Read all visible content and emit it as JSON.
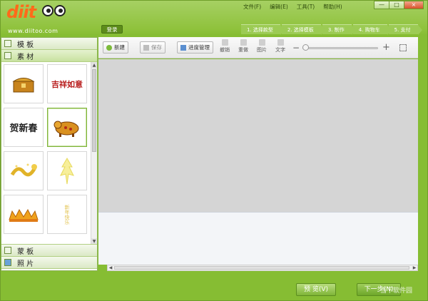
{
  "app": {
    "logo_text": "diit",
    "logo_url": "www.diitoo.com",
    "brand_color": "#ff6a1a",
    "theme_color": "#8fc23c"
  },
  "menu": [
    "文件(F)",
    "编辑(E)",
    "工具(T)",
    "帮助(H)"
  ],
  "window_controls": {
    "minimize": "—",
    "maximize": "□",
    "close": "×"
  },
  "login_label": "登录",
  "steps": [
    "1. 选择款型",
    "2. 选择模板",
    "3. 制作",
    "4. 购物车",
    "5. 支付"
  ],
  "left_panel": {
    "sections": [
      {
        "label": "模 板",
        "icon": "template-icon"
      },
      {
        "label": "素 材",
        "icon": "material-icon",
        "active": true
      },
      {
        "label": "蒙 板",
        "icon": "mask-icon"
      },
      {
        "label": "照 片",
        "icon": "photo-icon"
      }
    ],
    "thumbnails": [
      {
        "name": "treasure-chest",
        "text": ""
      },
      {
        "name": "calligraphy-red",
        "text": "吉祥如意"
      },
      {
        "name": "calligraphy-black",
        "text": "贺新春"
      },
      {
        "name": "golden-ox",
        "text": ""
      },
      {
        "name": "golden-dragon",
        "text": ""
      },
      {
        "name": "golden-ornament",
        "text": ""
      },
      {
        "name": "golden-crown",
        "text": ""
      },
      {
        "name": "calligraphy-gold",
        "text": "新年快乐"
      }
    ]
  },
  "toolbar": {
    "new_label": "新建",
    "save_label": "保存",
    "progress_label": "进度管理",
    "undo_label": "撤销",
    "redo_label": "重做",
    "picture_label": "图片",
    "text_label": "文字",
    "zoom_minus": "−",
    "zoom_plus": "+"
  },
  "footer": {
    "preview_label": "预 览(V)",
    "next_label": "下一步(N)"
  },
  "watermark": "当下软件园"
}
